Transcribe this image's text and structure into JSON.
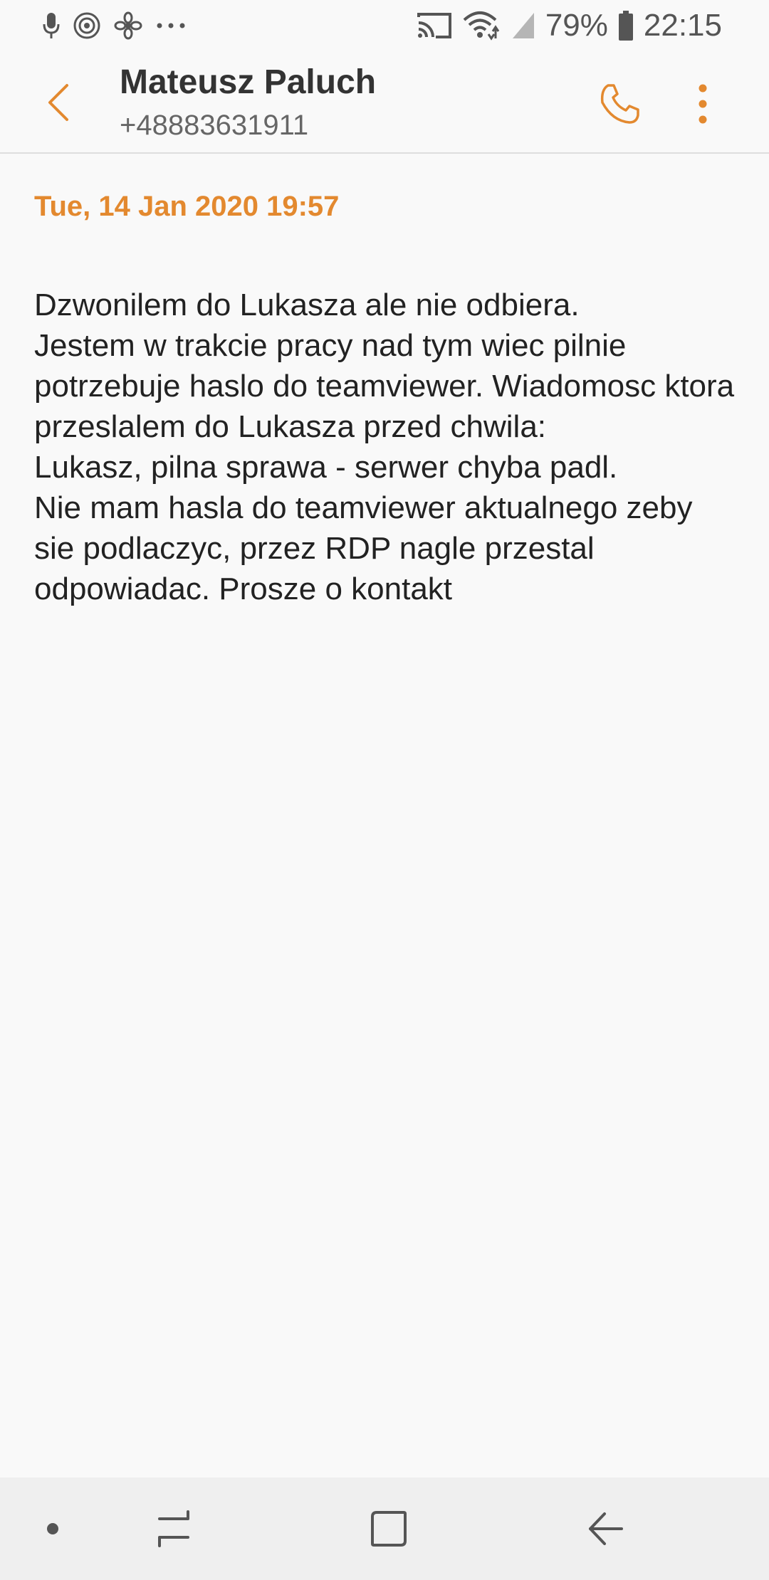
{
  "status_bar": {
    "icons_left": [
      "microphone-icon",
      "hotspot-icon",
      "fan-icon",
      "more-notifications-icon"
    ],
    "icons_right": [
      "cast-icon",
      "wifi-icon",
      "signal-icon",
      "battery-icon"
    ],
    "battery_percent": "79%",
    "time": "22:15"
  },
  "header": {
    "contact_name": "Mateusz Paluch",
    "phone_number": "+48883631911",
    "accent_color": "#e3892f"
  },
  "message": {
    "date": "Tue, 14 Jan 2020 19:57",
    "text": "Dzwonilem do Lukasza ale nie odbiera.\nJestem w trakcie pracy nad tym wiec pilnie potrzebuje haslo do teamviewer. Wiadomosc ktora przeslalem do Lukasza przed chwila:\nLukasz, pilna sprawa - serwer chyba padl.\nNie mam hasla do teamviewer aktualnego zeby sie podlaczyc, przez RDP nagle przestal odpowiadac. Prosze o kontakt"
  },
  "nav_bar": {
    "icons": [
      "dot-icon",
      "recents-icon",
      "home-icon",
      "back-icon"
    ]
  }
}
